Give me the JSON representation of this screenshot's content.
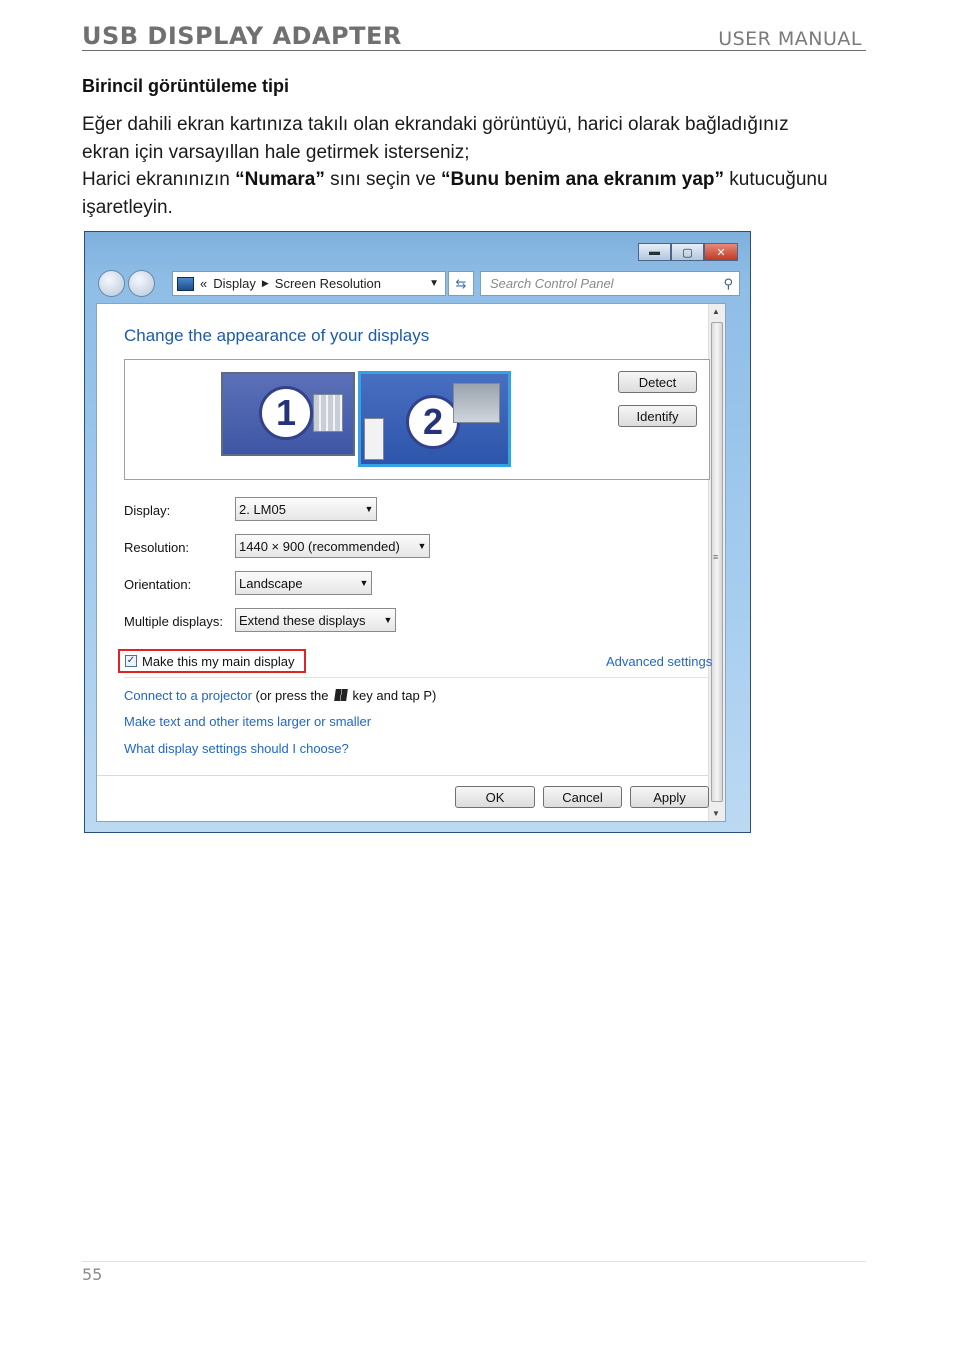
{
  "header": {
    "title": "USB DISPLAY ADAPTER",
    "subtitle": "USER MANUAL"
  },
  "section": {
    "title": "Birincil görüntüleme tipi",
    "line1": "Eğer dahili ekran kartınıza takılı olan ekrandaki görüntüyü, harici olarak bağladığınız",
    "line2": "ekran için varsayıllan hale getirmek isterseniz;",
    "line3_a": "Harici ekranınızın ",
    "line3_b": "“Numara”",
    "line3_c": " sını seçin ve ",
    "line3_d": "“Bunu benim ana ekranım yap”",
    "line3_e": " kutucuğunu",
    "line4": "işaretleyin."
  },
  "screenshot": {
    "breadcrumb": {
      "root": "«",
      "item1": "Display",
      "item2": "Screen Resolution"
    },
    "search_placeholder": "Search Control Panel",
    "heading": "Change the appearance of your displays",
    "monitors": [
      "1",
      "2"
    ],
    "detect_label": "Detect",
    "identify_label": "Identify",
    "display": {
      "label": "Display:",
      "value": "2. LM05"
    },
    "resolution": {
      "label": "Resolution:",
      "value": "1440 × 900 (recommended)"
    },
    "orientation": {
      "label": "Orientation:",
      "value": "Landscape"
    },
    "multiple": {
      "label": "Multiple displays:",
      "value": "Extend these displays"
    },
    "main_display_label": "Make this my main display",
    "main_display_checked": true,
    "advanced_label": "Advanced settings",
    "projector_link": "Connect to a projector",
    "projector_hint_a": "(or press the",
    "projector_hint_b": "key and tap P)",
    "larger_link": "Make text and other items larger or smaller",
    "choose_link": "What display settings should I choose?",
    "ok_label": "OK",
    "cancel_label": "Cancel",
    "apply_label": "Apply"
  },
  "footer": {
    "page_number": "55"
  }
}
